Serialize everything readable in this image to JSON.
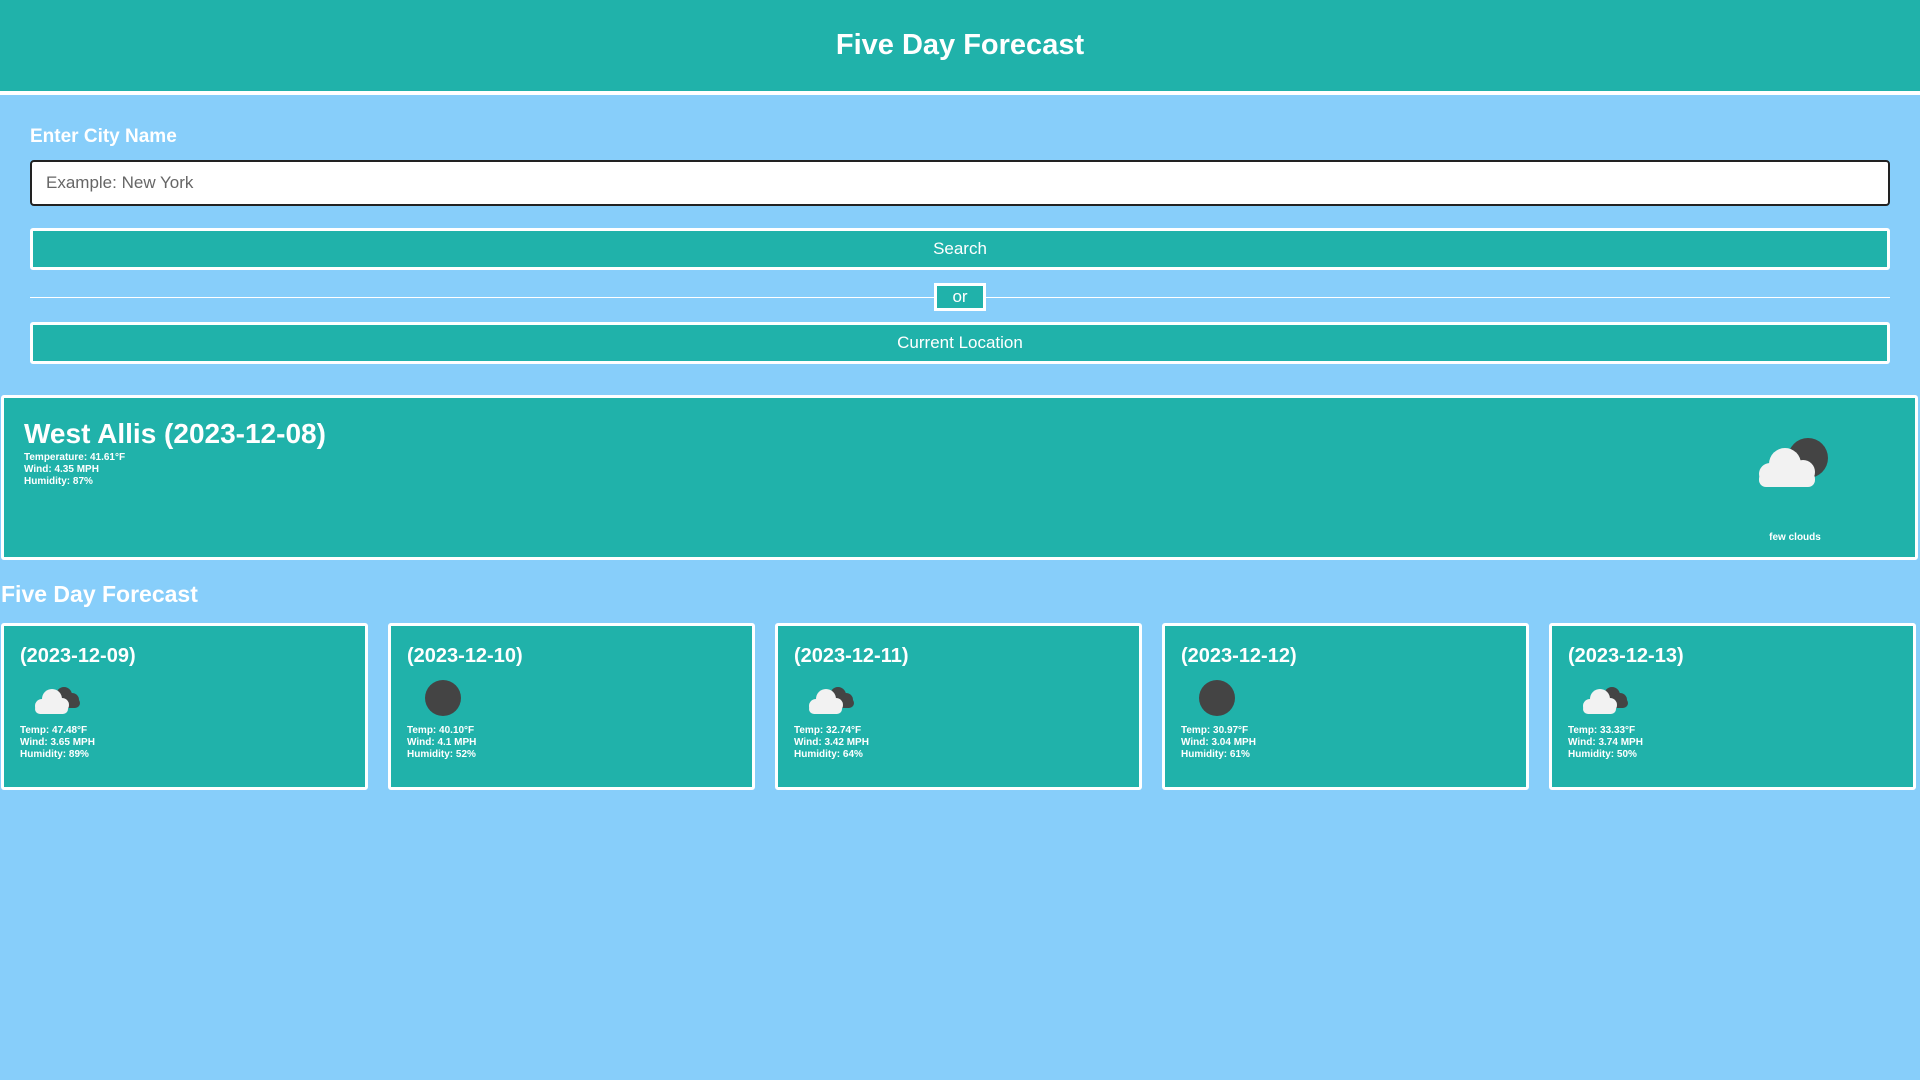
{
  "header": {
    "title": "Five Day Forecast"
  },
  "search": {
    "label": "Enter City Name",
    "placeholder": "Example: New York",
    "value": "",
    "search_button": "Search",
    "divider_text": "or",
    "location_button": "Current Location"
  },
  "current": {
    "title": "West Allis (2023-12-08)",
    "temperature": "Temperature: 41.61°F",
    "wind": "Wind: 4.35 MPH",
    "humidity": "Humidity: 87%",
    "icon": "few-clouds-icon",
    "description": "few clouds"
  },
  "forecast": {
    "title": "Five Day Forecast",
    "days": [
      {
        "date": "(2023-12-09)",
        "icon": "broken-clouds-icon",
        "temp": "Temp: 47.48°F",
        "wind": "Wind: 3.65 MPH",
        "humidity": "Humidity: 89%"
      },
      {
        "date": "(2023-12-10)",
        "icon": "clear-sky-icon",
        "temp": "Temp: 40.10°F",
        "wind": "Wind: 4.1 MPH",
        "humidity": "Humidity: 52%"
      },
      {
        "date": "(2023-12-11)",
        "icon": "broken-clouds-icon",
        "temp": "Temp: 32.74°F",
        "wind": "Wind: 3.42 MPH",
        "humidity": "Humidity: 64%"
      },
      {
        "date": "(2023-12-12)",
        "icon": "clear-sky-icon",
        "temp": "Temp: 30.97°F",
        "wind": "Wind: 3.04 MPH",
        "humidity": "Humidity: 61%"
      },
      {
        "date": "(2023-12-13)",
        "icon": "broken-clouds-icon",
        "temp": "Temp: 33.33°F",
        "wind": "Wind: 3.74 MPH",
        "humidity": "Humidity: 50%"
      }
    ]
  },
  "colors": {
    "background": "#87cefa",
    "accent": "#20b2aa",
    "border": "#ffffff",
    "icon_dark": "#444444",
    "icon_light": "#f2f2f2"
  }
}
